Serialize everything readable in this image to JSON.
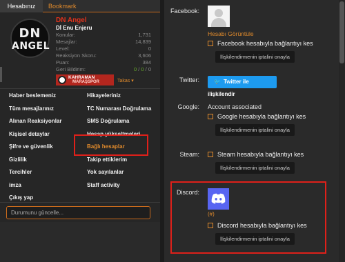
{
  "tabs": {
    "active": "Hesabınız",
    "other": "Bookmark"
  },
  "profile": {
    "avatar_line1": "DN",
    "avatar_line2": "ANGEL",
    "username": "DN Angel",
    "title": "Dİ Enu Enjeru",
    "stats": [
      {
        "label": "Konular:",
        "value": "1,731"
      },
      {
        "label": "Mesajlar:",
        "value": "14,839"
      },
      {
        "label": "Level:",
        "value": "0"
      },
      {
        "label": "Reaksiyon Skoru:",
        "value": "3,606"
      },
      {
        "label": "Puan:",
        "value": "384"
      }
    ],
    "geri_bildirim": {
      "label": "Geri Bildirim:",
      "v1": "0",
      "sep1": " / ",
      "v2": "0",
      "sep2": " / ",
      "v3": "0"
    },
    "banner_line1": "KAHRAMAN",
    "banner_line2": "MARAŞSPOR",
    "takas": "Takas ▾"
  },
  "menu": {
    "left": [
      "Haber beslemeniz",
      "Tüm mesajlarınız",
      "Alınan Reaksiyonlar",
      "Kişisel detaylar",
      "Şifre ve güvenlik",
      "Gizlilik",
      "Tercihler",
      "imza",
      "Çıkış yap"
    ],
    "right": [
      "Hikayeleriniz",
      "TC Numarası Doğrulama",
      "SMS Doğrulama",
      "Hesap yükseltmeleri",
      "Bağlı hesaplar",
      "Takip ettiklerim",
      "Yok sayılanlar",
      "Staff activity"
    ],
    "status_placeholder": "Durumunu güncelle..."
  },
  "accounts": {
    "facebook": {
      "label": "Facebook:",
      "view_profile": "Hesabı Görüntüle",
      "disconnect": "Facebook hesabıyla bağlantıyı kes",
      "confirm": "İlişkilendirmenin iptalini onayla"
    },
    "twitter": {
      "label": "Twitter:",
      "button": "Twitter ile ilişkilendir",
      "bird": "🐦"
    },
    "google": {
      "label": "Google:",
      "status": "Account associated",
      "disconnect": "Google hesabıyla bağlantıyı kes",
      "confirm": "İlişkilendirmenin iptalini onayla"
    },
    "steam": {
      "label": "Steam:",
      "disconnect": "Steam hesabıyla bağlantıyı kes",
      "confirm": "İlişkilendirmenin iptalini onayla"
    },
    "discord": {
      "label": "Discord:",
      "hash": "(#)",
      "disconnect": "Discord hesabıyla bağlantıyı kes",
      "confirm": "İlişkilendirmenin iptalini onayla"
    }
  },
  "colors": {
    "accent": "#e08a2c",
    "highlight_box": "#e0201a",
    "twitter": "#1d9bf0",
    "discord": "#5865f2",
    "username": "#e0321c"
  }
}
